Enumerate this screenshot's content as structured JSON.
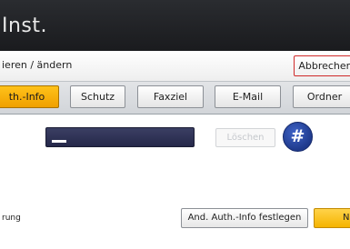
{
  "header": {
    "title": "Inst."
  },
  "edit_row": {
    "label": "ieren / ändern",
    "cancel_label": "Abbrechen"
  },
  "tabs": [
    {
      "label": "th.-Info",
      "selected": true
    },
    {
      "label": "Schutz",
      "selected": false
    },
    {
      "label": "Faxziel",
      "selected": false
    },
    {
      "label": "E-Mail",
      "selected": false
    },
    {
      "label": "Ordner",
      "selected": false
    }
  ],
  "password_entry": {
    "value": "",
    "clear_label": "Löschen",
    "clear_enabled": false,
    "hash_label": "#"
  },
  "footer": {
    "label": "rung",
    "set_auth_label": "And. Auth.-Info festlegen",
    "next_label": "N"
  },
  "colors": {
    "titlebar": "#1f2023",
    "selected_tab": "#f5a800",
    "cancel_border": "#d02a2a",
    "input_bg": "#2f3356",
    "hash_button": "#2b4ea8"
  }
}
